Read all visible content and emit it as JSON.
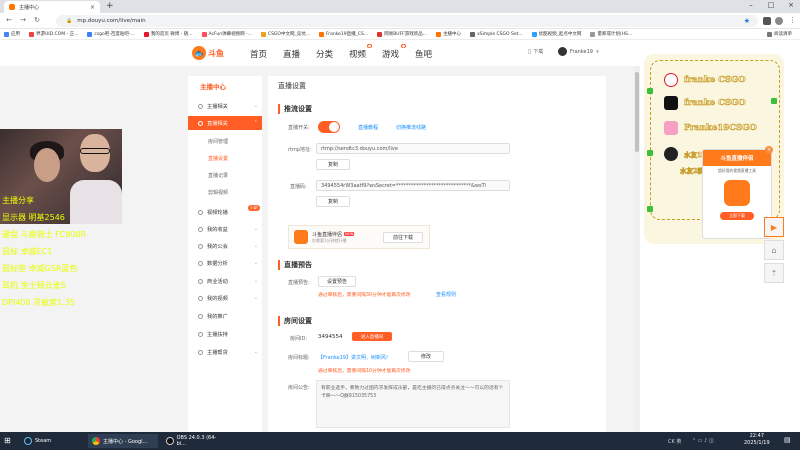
{
  "browser": {
    "tab_title": "主播中心",
    "url": "mp.douyu.com/live/main",
    "bookmarks": [
      "应用",
      "界游UID.COM - 正...",
      "csgo吧-百度贴吧-...",
      "我的首页 微博 - 随...",
      "AcFun弹幕视频网 -...",
      "CSGO中文网_竞坑...",
      "Franke19直播_CS...",
      "网易BUFF游戏饰品...",
      "主播中心",
      "xSimple CSGO Set...",
      "优酷视频_起点中文网",
      "量筹或计划(HS...",
      "阅读清单"
    ]
  },
  "header": {
    "logo_text": "斗鱼",
    "nav": [
      "首页",
      "直播",
      "分类",
      "视频",
      "游戏",
      "鱼吧"
    ],
    "download": "下载",
    "username": "Franke19"
  },
  "sidebar": {
    "title": "主播中心",
    "items": [
      {
        "label": "主播相关"
      },
      {
        "label": "直播相关",
        "active": true
      },
      {
        "label": "视频轮播"
      },
      {
        "label": "我的收益"
      },
      {
        "label": "我的公会"
      },
      {
        "label": "数据分析"
      },
      {
        "label": "商业活动"
      },
      {
        "label": "我的视频"
      },
      {
        "label": "我的推广"
      },
      {
        "label": "主播扶持"
      },
      {
        "label": "主播帮货"
      }
    ],
    "subitems": [
      "房间管理",
      "直播设置",
      "直播记录",
      "剪辑视频"
    ],
    "badge": "小助"
  },
  "main": {
    "page_title": "直播设置",
    "push": {
      "section": "推流设置",
      "switch_label": "直播开关:",
      "links": [
        "直播教程",
        "切换推流线路"
      ],
      "rtmp_label": "rtmp地址:",
      "rtmp_value": "rtmp://sendtc3.douyu.com/live",
      "copy": "复制",
      "code_label": "直播码:",
      "code_value": "3494554rW3aatf9?wsSecret=******************************&wsTi"
    },
    "promo": {
      "title": "斗鱼直播伴侣",
      "new": "NEW",
      "sub": "仅需要1分钟就开播",
      "btn": "前往下载"
    },
    "preview": {
      "section": "直播预告",
      "label": "直播预告:",
      "btn": "设置预告",
      "warn": "通过审核后，需要间隔30分钟才能再次修改",
      "link": "查看规则"
    },
    "room": {
      "section": "房间设置",
      "id_label": "房间ID:",
      "id_value": "3494554",
      "enter": "进入直播间",
      "name_label": "房间标题:",
      "name_value": "【Franke19】讲文明、树新风!",
      "edit": "修改",
      "name_warn": "通过审核后，需要间隔10分钟才能再次修改",
      "announce_label": "房间公告:",
      "announce": "有职业选手，要致力过国内求发挥成乐部，是吃主播的已得点点关注～～可以的话有个卡映～～Q群915035753"
    }
  },
  "overlay": {
    "yellow_lines": [
      "主播分享",
      "显示器 明基2546",
      "键盘 斗鹿骑士 FC900R",
      "鼠标 卓威EC1",
      "鼠标垫 卓威GSR蓝色",
      "耳机 金士顿云雀S",
      "DPI400 灵敏度1.35"
    ],
    "socials": [
      "franke CSGO",
      "franke CSGO",
      "Franke19CSGO",
      "水友1群 915035753",
      "水友2群 1141749889"
    ],
    "popup_title": "斗鱼直播伴侣",
    "popup_sub": "超好用的视频直播工具",
    "popup_btn": "立即下载"
  },
  "taskbar": {
    "apps": [
      "Steam",
      "主播中心 - Googl...",
      "OBS 24.0.3 (64-bi..."
    ],
    "time": "22:47",
    "date": "2025/1/19",
    "ime": "CK 英"
  }
}
